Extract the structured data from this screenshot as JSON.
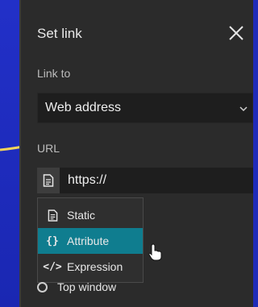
{
  "dialog": {
    "title": "Set link",
    "link_to_label": "Link to",
    "link_to_value": "Web address",
    "url_label": "URL",
    "url_value": "https://"
  },
  "menu": {
    "items": [
      {
        "label": "Static",
        "icon": "document-icon"
      },
      {
        "label": "Attribute",
        "icon": "braces-icon"
      },
      {
        "label": "Expression",
        "icon": "code-icon"
      }
    ],
    "active_index": 1
  },
  "target": {
    "option_label": "Top window"
  },
  "colors": {
    "background": "#1f2bb8",
    "panel": "#2b2b2b",
    "field": "#1e1e1e",
    "accent": "#0f7d8f",
    "annotation_arrow": "#f4d55a"
  }
}
